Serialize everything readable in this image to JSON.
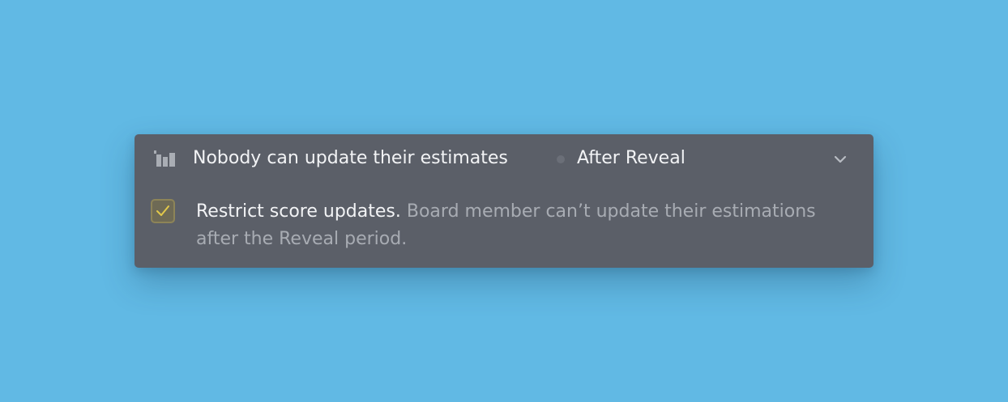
{
  "setting": {
    "icon": "bar-chart-icon",
    "title": "Nobody can update their estimates",
    "value": "After Reveal",
    "expand_icon": "chevron-down-icon"
  },
  "option": {
    "checked": true,
    "checkbox_icon": "checkmark-icon",
    "label": "Restrict score updates.",
    "description": "Board member can’t update their estimations after the Reveal period."
  },
  "colors": {
    "background": "#61b9e4",
    "panel": "#5b5f68",
    "checkbox_accent": "#e2c84a"
  }
}
